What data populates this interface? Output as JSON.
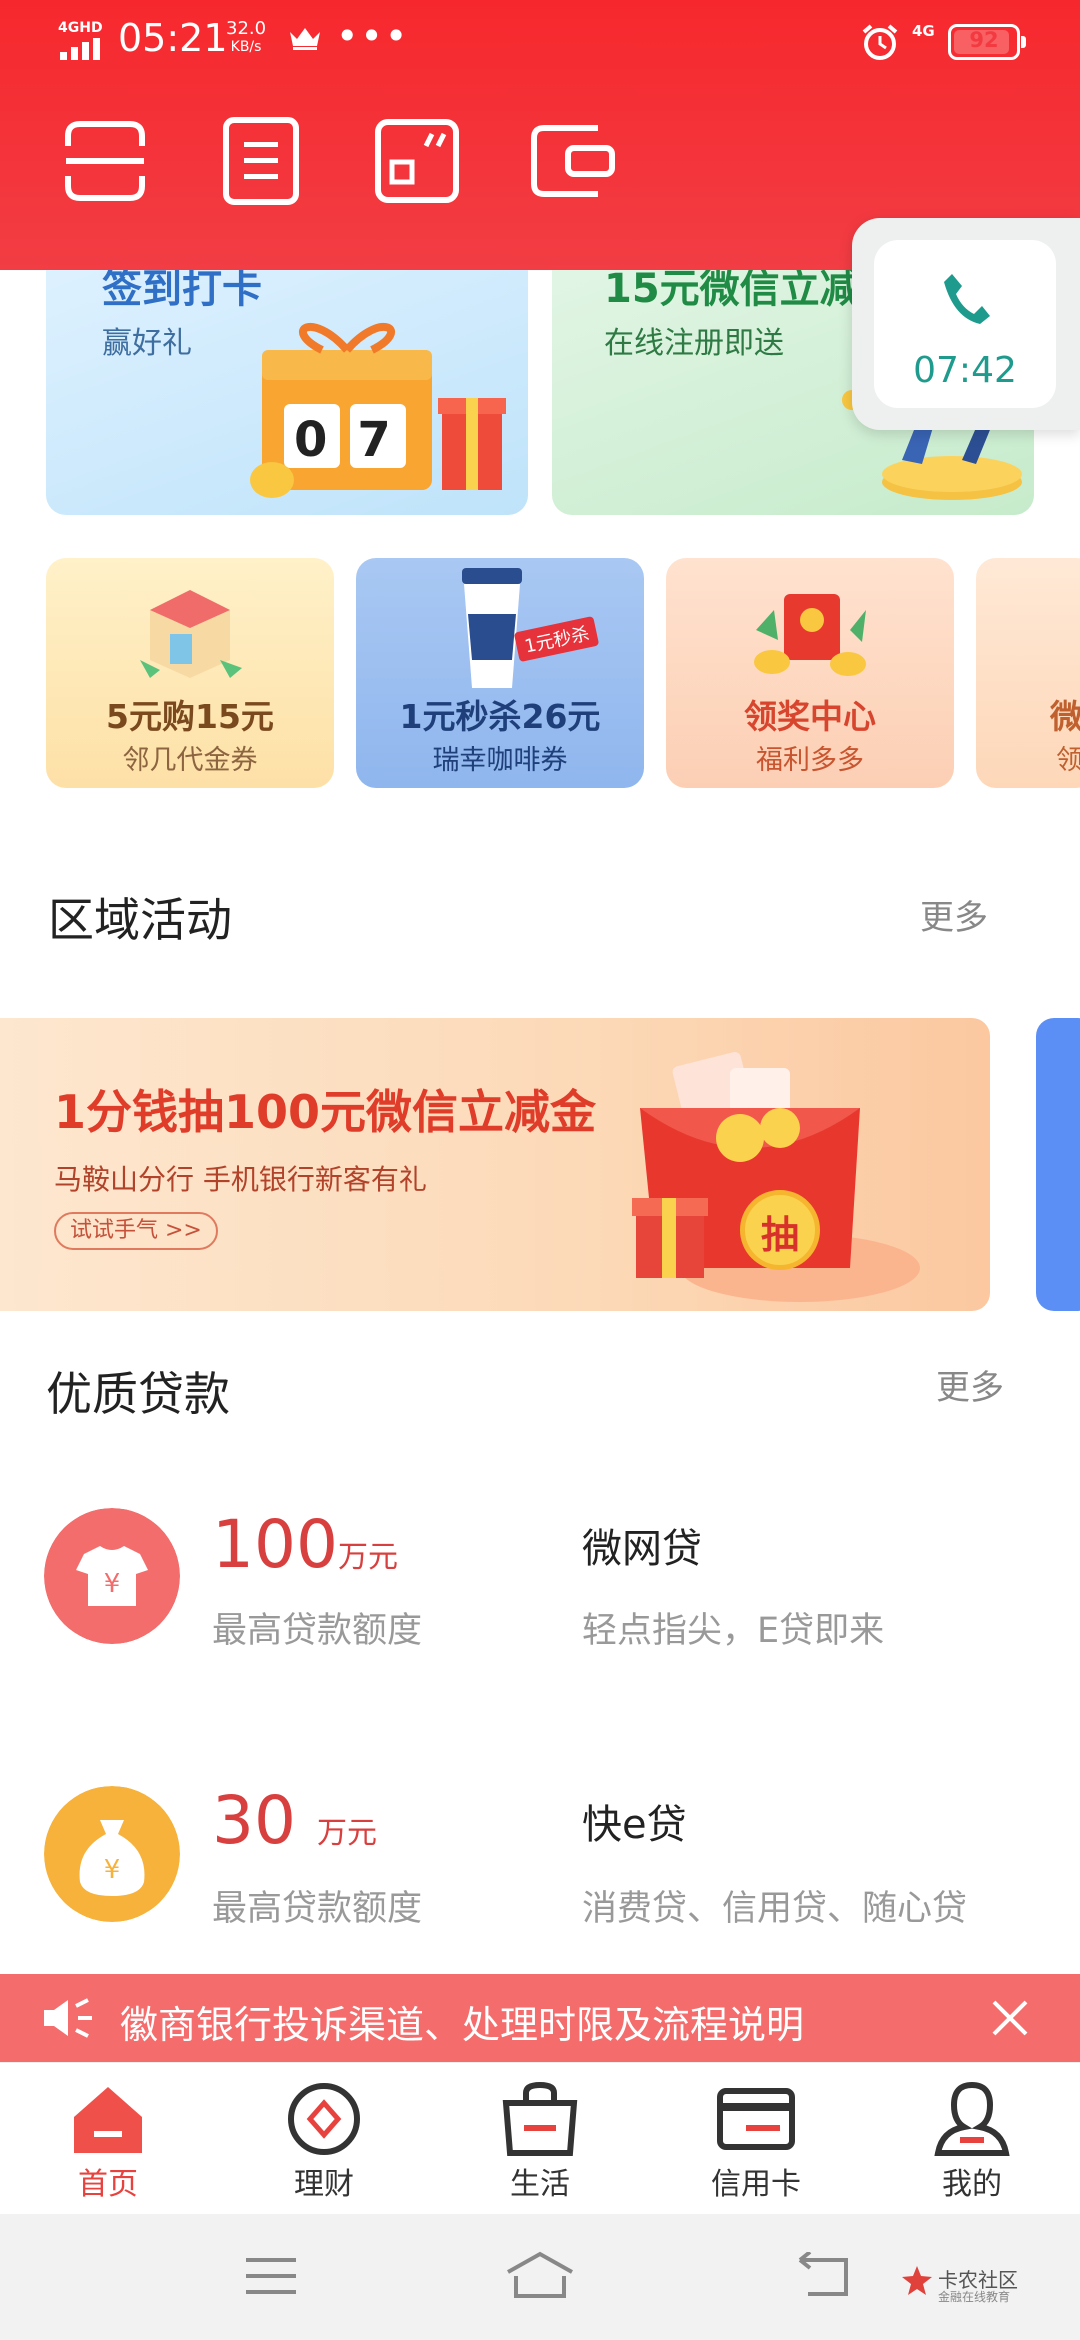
{
  "status_bar": {
    "network": "4GHD",
    "time": "05:21",
    "speed_value": "32.0",
    "speed_unit": "KB/s",
    "dots": "•••",
    "network2": "4G",
    "battery": "92",
    "battery_level": 0.92
  },
  "header_icons": [
    "scan-icon",
    "bill-icon",
    "qrcode-icon",
    "wallet-icon"
  ],
  "promo_cards": [
    {
      "title": "签到打卡",
      "subtitle": "赢好礼",
      "badge": "07"
    },
    {
      "title": "15元微信立减",
      "subtitle": "在线注册即送"
    }
  ],
  "call_widget": {
    "time": "07:42"
  },
  "mini_cards": [
    {
      "title": "5元购15元",
      "subtitle": "邻几代金券"
    },
    {
      "title": "1元秒杀26元",
      "subtitle": "瑞幸咖啡券",
      "tag": "1元秒杀"
    },
    {
      "title": "领奖中心",
      "subtitle": "福利多多"
    },
    {
      "title": "微",
      "subtitle": "领"
    }
  ],
  "regional": {
    "title": "区域活动",
    "more": "更多",
    "banner": {
      "headline": "1分钱抽100元微信立减金",
      "sub": "马鞍山分行  手机银行新客有礼",
      "button": "试试手气 >>",
      "badge": "抽"
    }
  },
  "loans": {
    "title": "优质贷款",
    "more": "更多",
    "items": [
      {
        "amount": "100",
        "unit": "万元",
        "sub": "最高贷款额度",
        "name": "微网贷",
        "desc": "轻点指尖，E贷即来",
        "color": "#f26d6b"
      },
      {
        "amount": "30",
        "unit": "万元",
        "sub": "最高贷款额度",
        "name": "快e贷",
        "desc": "消费贷、信用贷、随心贷",
        "color": "#f7b23b"
      }
    ]
  },
  "notice": {
    "text": "徽商银行投诉渠道、处理时限及流程说明"
  },
  "tabs": [
    {
      "label": "首页",
      "icon": "home-icon",
      "active": true
    },
    {
      "label": "理财",
      "icon": "finance-icon"
    },
    {
      "label": "生活",
      "icon": "shopping-bag-icon"
    },
    {
      "label": "信用卡",
      "icon": "credit-card-icon"
    },
    {
      "label": "我的",
      "icon": "profile-icon"
    }
  ],
  "watermark": {
    "line1": "卡农社区",
    "line2": "金融在线教育"
  },
  "colors": {
    "brand_red": "#f2282e",
    "accent_green": "#1f9b8e",
    "notice_bg": "#f56c6c"
  }
}
